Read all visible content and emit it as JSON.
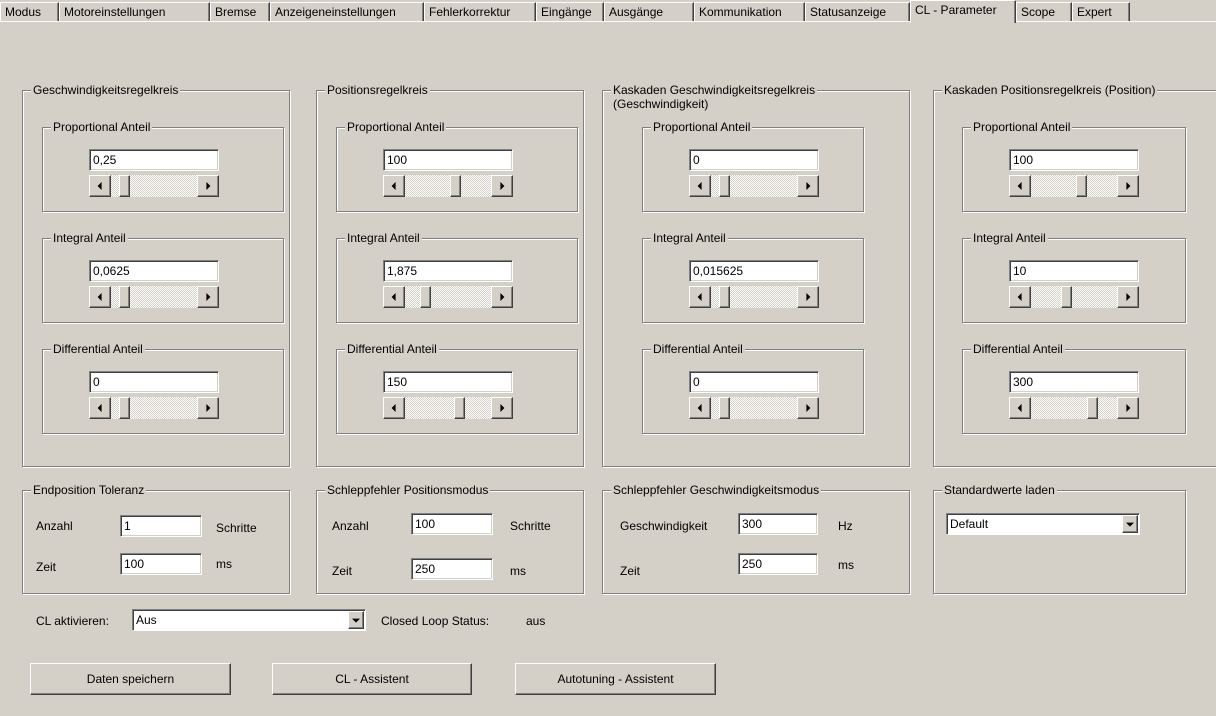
{
  "tabs": [
    {
      "label": "Modus"
    },
    {
      "label": "Motoreinstellungen"
    },
    {
      "label": "Bremse"
    },
    {
      "label": "Anzeigeneinstellungen"
    },
    {
      "label": "Fehlerkorrektur"
    },
    {
      "label": "Eingänge"
    },
    {
      "label": "Ausgänge"
    },
    {
      "label": "Kommunikation"
    },
    {
      "label": "Statusanzeige"
    },
    {
      "label": "CL - Parameter",
      "active": true
    },
    {
      "label": "Scope"
    },
    {
      "label": "Expert"
    }
  ],
  "controllers": [
    {
      "title": "Geschwindigkeitsregelkreis",
      "proportional": {
        "label": "Proportional Anteil",
        "value": "0,25",
        "slider_pos": 0.1
      },
      "integral": {
        "label": "Integral Anteil",
        "value": "0,0625",
        "slider_pos": 0.1
      },
      "differential": {
        "label": "Differential Anteil",
        "value": "0",
        "slider_pos": 0.1
      }
    },
    {
      "title": "Positionsregelkreis",
      "proportional": {
        "label": "Proportional Anteil",
        "value": "100",
        "slider_pos": 0.6
      },
      "integral": {
        "label": "Integral Anteil",
        "value": "1,875",
        "slider_pos": 0.2
      },
      "differential": {
        "label": "Differential Anteil",
        "value": "150",
        "slider_pos": 0.65
      }
    },
    {
      "title": "Kaskaden Geschwindigkeitsregelkreis (Geschwindigkeit)",
      "title_line1": "Kaskaden Geschwindigkeitsregelkreis",
      "title_line2": "(Geschwindigkeit)",
      "proportional": {
        "label": "Proportional Anteil",
        "value": "0",
        "slider_pos": 0.1
      },
      "integral": {
        "label": "Integral Anteil",
        "value": "0,015625",
        "slider_pos": 0.1
      },
      "differential": {
        "label": "Differential Anteil",
        "value": "0",
        "slider_pos": 0.1
      }
    },
    {
      "title": "Kaskaden Positionsregelkreis (Position)",
      "proportional": {
        "label": "Proportional Anteil",
        "value": "100",
        "slider_pos": 0.6
      },
      "integral": {
        "label": "Integral Anteil",
        "value": "10",
        "slider_pos": 0.4
      },
      "differential": {
        "label": "Differential Anteil",
        "value": "300",
        "slider_pos": 0.75
      }
    }
  ],
  "endposition": {
    "title": "Endposition Toleranz",
    "count_label": "Anzahl",
    "count_value": "1",
    "count_unit": "Schritte",
    "time_label": "Zeit",
    "time_value": "100",
    "time_unit": "ms"
  },
  "follow_pos": {
    "title": "Schleppfehler Positionsmodus",
    "count_label": "Anzahl",
    "count_value": "100",
    "count_unit": "Schritte",
    "time_label": "Zeit",
    "time_value": "250",
    "time_unit": "ms"
  },
  "follow_speed": {
    "title": "Schleppfehler Geschwindigkeitsmodus",
    "speed_label": "Geschwindigkeit",
    "speed_value": "300",
    "speed_unit": "Hz",
    "time_label": "Zeit",
    "time_value": "250",
    "time_unit": "ms"
  },
  "defaults": {
    "title": "Standardwerte laden",
    "selected": "Default"
  },
  "cl": {
    "activate_label": "CL aktivieren:",
    "activate_value": "Aus",
    "status_label": "Closed Loop Status:",
    "status_value": "aus"
  },
  "buttons": {
    "save": "Daten speichern",
    "cl_assistant": "CL - Assistent",
    "autotune": "Autotuning - Assistent"
  }
}
